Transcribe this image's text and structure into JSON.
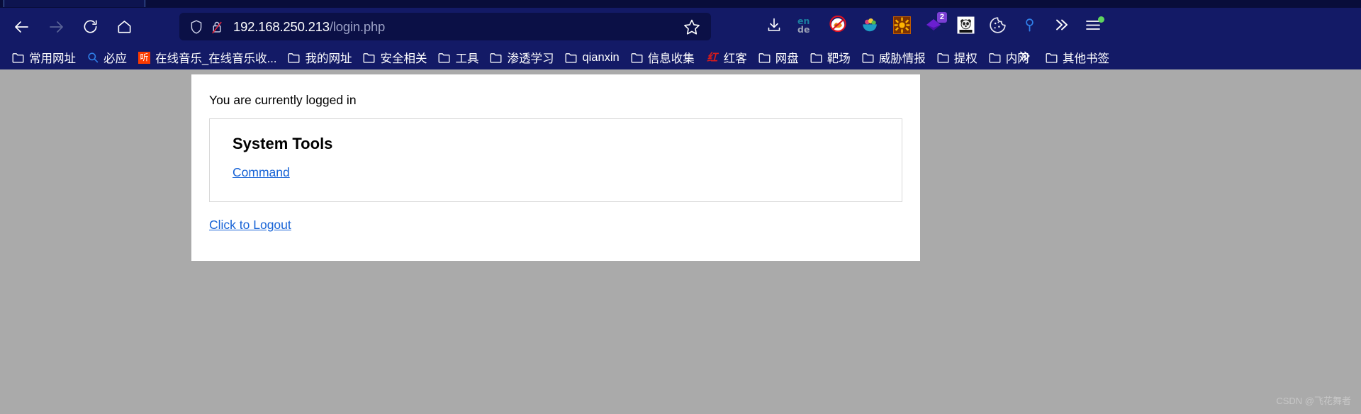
{
  "browser": {
    "nav": {
      "back": "back-arrow",
      "forward": "forward-arrow",
      "reload": "reload",
      "home": "home"
    },
    "url_bar": {
      "host": "192.168.250.213",
      "path": "/login.php",
      "shield_icon": "shield-icon",
      "security_icon": "lock-insecure-icon",
      "bookmark_icon": "star-icon"
    },
    "toolbar_icons": [
      {
        "name": "download-icon",
        "badge": ""
      },
      {
        "name": "translate-en-de-icon",
        "badge": ""
      },
      {
        "name": "block-fox-icon",
        "badge": ""
      },
      {
        "name": "fruit-bowl-icon",
        "badge": ""
      },
      {
        "name": "orange-gear-icon",
        "badge": ""
      },
      {
        "name": "purple-diamond-icon",
        "badge": "2"
      },
      {
        "name": "panda-icon",
        "badge": ""
      },
      {
        "name": "cookie-icon",
        "badge": ""
      },
      {
        "name": "blue-pin-icon",
        "badge": ""
      },
      {
        "name": "chevron-double-right-icon",
        "badge": ""
      },
      {
        "name": "hamburger-menu-icon",
        "badge": ""
      }
    ],
    "bookmarks": [
      {
        "label": "常用网址",
        "icon": "folder"
      },
      {
        "label": "必应",
        "icon": "search"
      },
      {
        "label": "在线音乐_在线音乐收...",
        "icon": "ting"
      },
      {
        "label": "我的网址",
        "icon": "folder"
      },
      {
        "label": "安全相关",
        "icon": "folder"
      },
      {
        "label": "工具",
        "icon": "folder"
      },
      {
        "label": "渗透学习",
        "icon": "folder"
      },
      {
        "label": "qianxin",
        "icon": "folder"
      },
      {
        "label": "信息收集",
        "icon": "folder"
      },
      {
        "label": "红客",
        "icon": "hong"
      },
      {
        "label": "网盘",
        "icon": "folder"
      },
      {
        "label": "靶场",
        "icon": "folder"
      },
      {
        "label": "威胁情报",
        "icon": "folder"
      },
      {
        "label": "提权",
        "icon": "folder"
      },
      {
        "label": "内网",
        "icon": "folder"
      }
    ],
    "bookmarks_overflow_label": "»",
    "other_bookmarks_label": "其他书签"
  },
  "page": {
    "logged_in_message": "You are currently logged in",
    "tools_panel": {
      "heading": "System Tools",
      "command_link": "Command"
    },
    "logout_link": "Click to Logout"
  },
  "watermark": "CSDN @飞花舞者",
  "colors": {
    "chrome_bg": "#131a66",
    "urlbar_bg": "#0b1046",
    "link": "#1763d6",
    "page_bg": "#aaaaaa",
    "card_bg": "#ffffff",
    "badge": "#7b3fd4"
  }
}
